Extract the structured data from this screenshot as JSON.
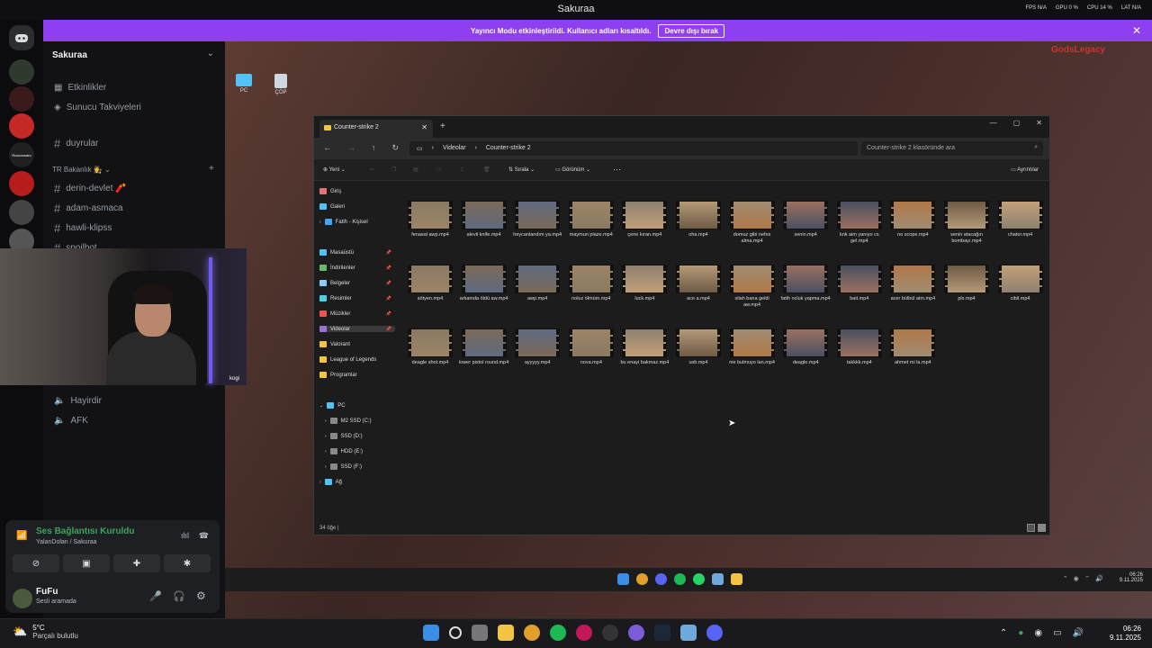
{
  "app_title": "Sakuraa",
  "overlay_stats": [
    "FPS N/A",
    "GPU 0 %",
    "CPU 14 %",
    "LAT N/A"
  ],
  "banner": {
    "text": "Yayıncı Modu etkinleştirildi. Kullanıcı adları kısaltıldı.",
    "button": "Devre dışı bırak",
    "close": "✕"
  },
  "rail": {
    "label": "Rocconsaro"
  },
  "sidebar": {
    "server_name": "Sakuraa",
    "items": [
      {
        "label": "Etkinlikler"
      },
      {
        "label": "Sunucu Takviyeleri"
      },
      {
        "label": "duyrular"
      }
    ],
    "category": "TR Bakanlık 👩‍⚖️",
    "channels": [
      "derin-devlet 🧨",
      "adam-asmaca",
      "hawli-klipss",
      "spoilbot"
    ],
    "voice_channels": [
      "Hayirdir",
      "AFK"
    ]
  },
  "webcam": {
    "tag": "kogi"
  },
  "voice": {
    "status": "Ses Bağlantısı Kuruldu",
    "location": "YalanDolan / Sakuraa",
    "user": "FuFu",
    "user_status": "Sesli aramada"
  },
  "desktop": {
    "icons": [
      "PC",
      "ÇÖP"
    ]
  },
  "explorer": {
    "tab_title": "Counter-strike 2",
    "breadcrumb": [
      "Videolar",
      "Counter-strike 2"
    ],
    "search_placeholder": "Counter-strike 2 klasöründe ara",
    "commands": {
      "new": "Yeni",
      "sort": "Sırala",
      "view": "Görünüm",
      "more": "···",
      "details": "Ayrıntılar"
    },
    "nav": {
      "top": [
        "Giriş",
        "Galeri",
        "Fatih - Kişisel"
      ],
      "quick": [
        "Masaüstü",
        "İndirilenler",
        "Belgeler",
        "Resimler",
        "Müzikler",
        "Videolar",
        "Valorant",
        "League of Legends",
        "Programlar"
      ],
      "pc": "PC",
      "drives": [
        "M2 SSD (C:)",
        "SSD (D:)",
        "HDD (E:)",
        "SSD (F:)"
      ],
      "network": "Ağ"
    },
    "files": [
      "fenasal awp.mp4",
      "alevli knife.mp4",
      "heycanlandım ya.mp4",
      "maymun plaze.mp4",
      "çene kıran.mp4",
      "oha.mp4",
      "domuz gibi nefes alma.mp4",
      "senin.mp4",
      "knk aim yanıyo cs gel.mp4",
      "no scope.mp4",
      "senin atacağın bombayı.mp4",
      "chator.mp4",
      "sötyen.mp4",
      "arkamda öldü aw.mp4",
      "awp.mp4",
      "noluz ölmüm.mp4",
      "luck.mp4",
      "ace a.mp4",
      "silah bana geldi aw.mp4",
      "fatih ocluk yapma.mp4",
      "bait.mp4",
      "acer bülbül aim.mp4",
      "pls.mp4",
      "cibil.mp4",
      "deagle shot.mp4",
      "lower pistol round.mp4",
      "ayyyyy.mp4",
      "nova.mp4",
      "bu enayi bakmaz.mp4",
      "usb.mp4",
      "nie bulmuyo lan.mp4",
      "deagle.mp4",
      "takkkk.mp4",
      "ahmet mi la.mp4"
    ],
    "status": "34 öğe"
  },
  "inner_clock": {
    "time": "06:26",
    "date": "9.11.2025"
  },
  "weather": {
    "temp": "5°C",
    "desc": "Parçalı bulutlu"
  },
  "clock": {
    "time": "06:26",
    "date": "9.11.2025"
  },
  "logo": "GodsLegacy",
  "colors": {
    "accent": "#8e3ff0",
    "voice_green": "#3ba55d"
  }
}
